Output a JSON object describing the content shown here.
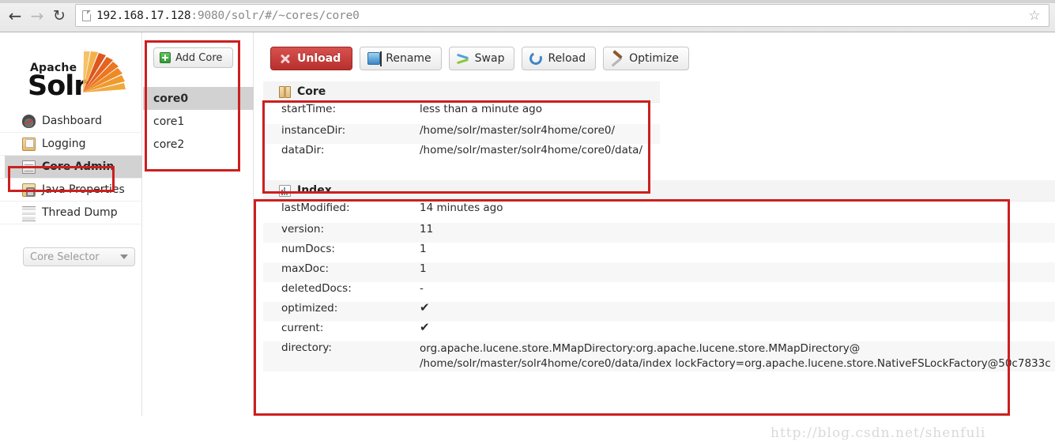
{
  "browser": {
    "back_icon": "back-arrow-icon",
    "forward_icon": "forward-arrow-icon",
    "reload_icon": "reload-icon",
    "page_icon": "page-document-icon",
    "url_host": "192.168.17.128",
    "url_rest": ":9080/solr/#/~cores/core0",
    "url_full": "192.168.17.128:9080/solr/#/~cores/core0",
    "bookmark_icon": "☆"
  },
  "sidebar": {
    "logo": {
      "line1": "Apache",
      "line2": "Solr"
    },
    "items": [
      {
        "label": "Dashboard",
        "icon": "gauge-icon",
        "active": false
      },
      {
        "label": "Logging",
        "icon": "logging-tray-icon",
        "active": false
      },
      {
        "label": "Core Admin",
        "icon": "core-admin-icon",
        "active": true
      },
      {
        "label": "Java Properties",
        "icon": "java-jar-icon",
        "active": false
      },
      {
        "label": "Thread Dump",
        "icon": "thread-dump-icon",
        "active": false
      }
    ],
    "core_selector": {
      "label": "Core Selector",
      "caret_icon": "chevron-down-icon"
    }
  },
  "core_list": {
    "add_core_label": "Add Core",
    "add_core_icon": "plus-icon",
    "cores": [
      {
        "name": "core0",
        "selected": true
      },
      {
        "name": "core1",
        "selected": false
      },
      {
        "name": "core2",
        "selected": false
      }
    ]
  },
  "toolbar": {
    "buttons": [
      {
        "label": "Unload",
        "icon": "x-mark-icon",
        "style": "danger"
      },
      {
        "label": "Rename",
        "icon": "rename-icon",
        "style": "normal"
      },
      {
        "label": "Swap",
        "icon": "swap-icon",
        "style": "normal"
      },
      {
        "label": "Reload",
        "icon": "reload-icon",
        "style": "normal"
      },
      {
        "label": "Optimize",
        "icon": "optimize-icon",
        "style": "normal"
      }
    ]
  },
  "core_panel": {
    "title": "Core",
    "icon": "box-icon",
    "rows": [
      {
        "key": "startTime:",
        "value": "less than a minute ago"
      },
      {
        "key": "instanceDir:",
        "value": "/home/solr/master/solr4home/core0/"
      },
      {
        "key": "dataDir:",
        "value": "/home/solr/master/solr4home/core0/data/"
      }
    ]
  },
  "index_panel": {
    "title": "Index",
    "icon": "bar-chart-icon",
    "rows": [
      {
        "key": "lastModified:",
        "value": "14 minutes ago"
      },
      {
        "key": "version:",
        "value": "11"
      },
      {
        "key": "numDocs:",
        "value": "1"
      },
      {
        "key": "maxDoc:",
        "value": "1"
      },
      {
        "key": "deletedDocs:",
        "value": "-"
      },
      {
        "key": "optimized:",
        "value": "✔",
        "is_check": true
      },
      {
        "key": "current:",
        "value": "✔",
        "is_check": true
      }
    ],
    "directory": {
      "key": "directory:",
      "line1": "org.apache.lucene.store.MMapDirectory:org.apache.lucene.store.MMapDirectory@",
      "line2": "/home/solr/master/solr4home/core0/data/index lockFactory=org.apache.lucene.store.NativeFSLockFactory@50c7833c"
    }
  },
  "annotations": {
    "color": "#cc1f1f"
  },
  "watermark": "http://blog.csdn.net/shenfuli"
}
